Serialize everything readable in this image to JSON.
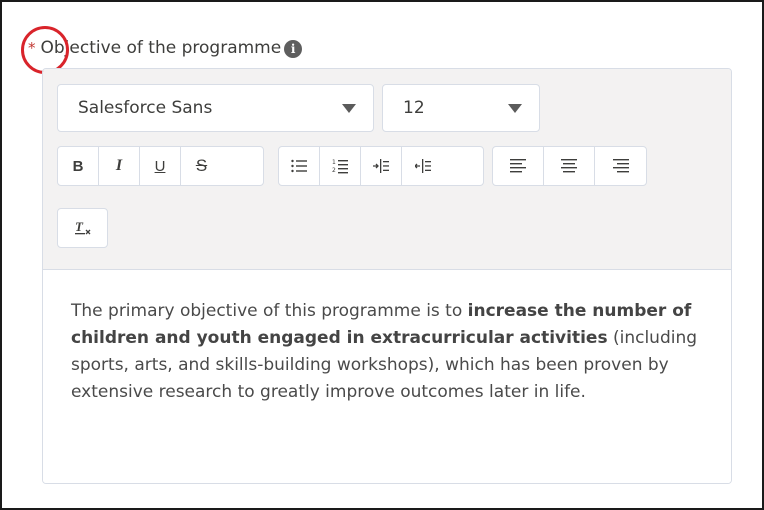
{
  "field": {
    "required_marker": "*",
    "label": "Objective of the programme",
    "info_icon": "info-icon"
  },
  "toolbar": {
    "font_family": "Salesforce Sans",
    "font_size": "12",
    "formatting_buttons": [
      "B",
      "I",
      "U",
      "S"
    ],
    "list_buttons": [
      "bulleted-list-icon",
      "numbered-list-icon",
      "indent-icon",
      "outdent-icon"
    ],
    "align_buttons": [
      "align-left-icon",
      "align-center-icon",
      "align-right-icon"
    ],
    "clear_formatting": "clear-formatting-icon"
  },
  "content": {
    "part1": "The primary objective of this programme is to ",
    "bold": "increase the number of children and youth engaged in extracurricular activities",
    "part2": " (including sports, arts, and skills-building workshops), which has been proven by extensive research to greatly improve outcomes later in life."
  },
  "colors": {
    "required": "#c23934",
    "annotation": "#d9242b",
    "toolbar_bg": "#f3f2f2"
  }
}
